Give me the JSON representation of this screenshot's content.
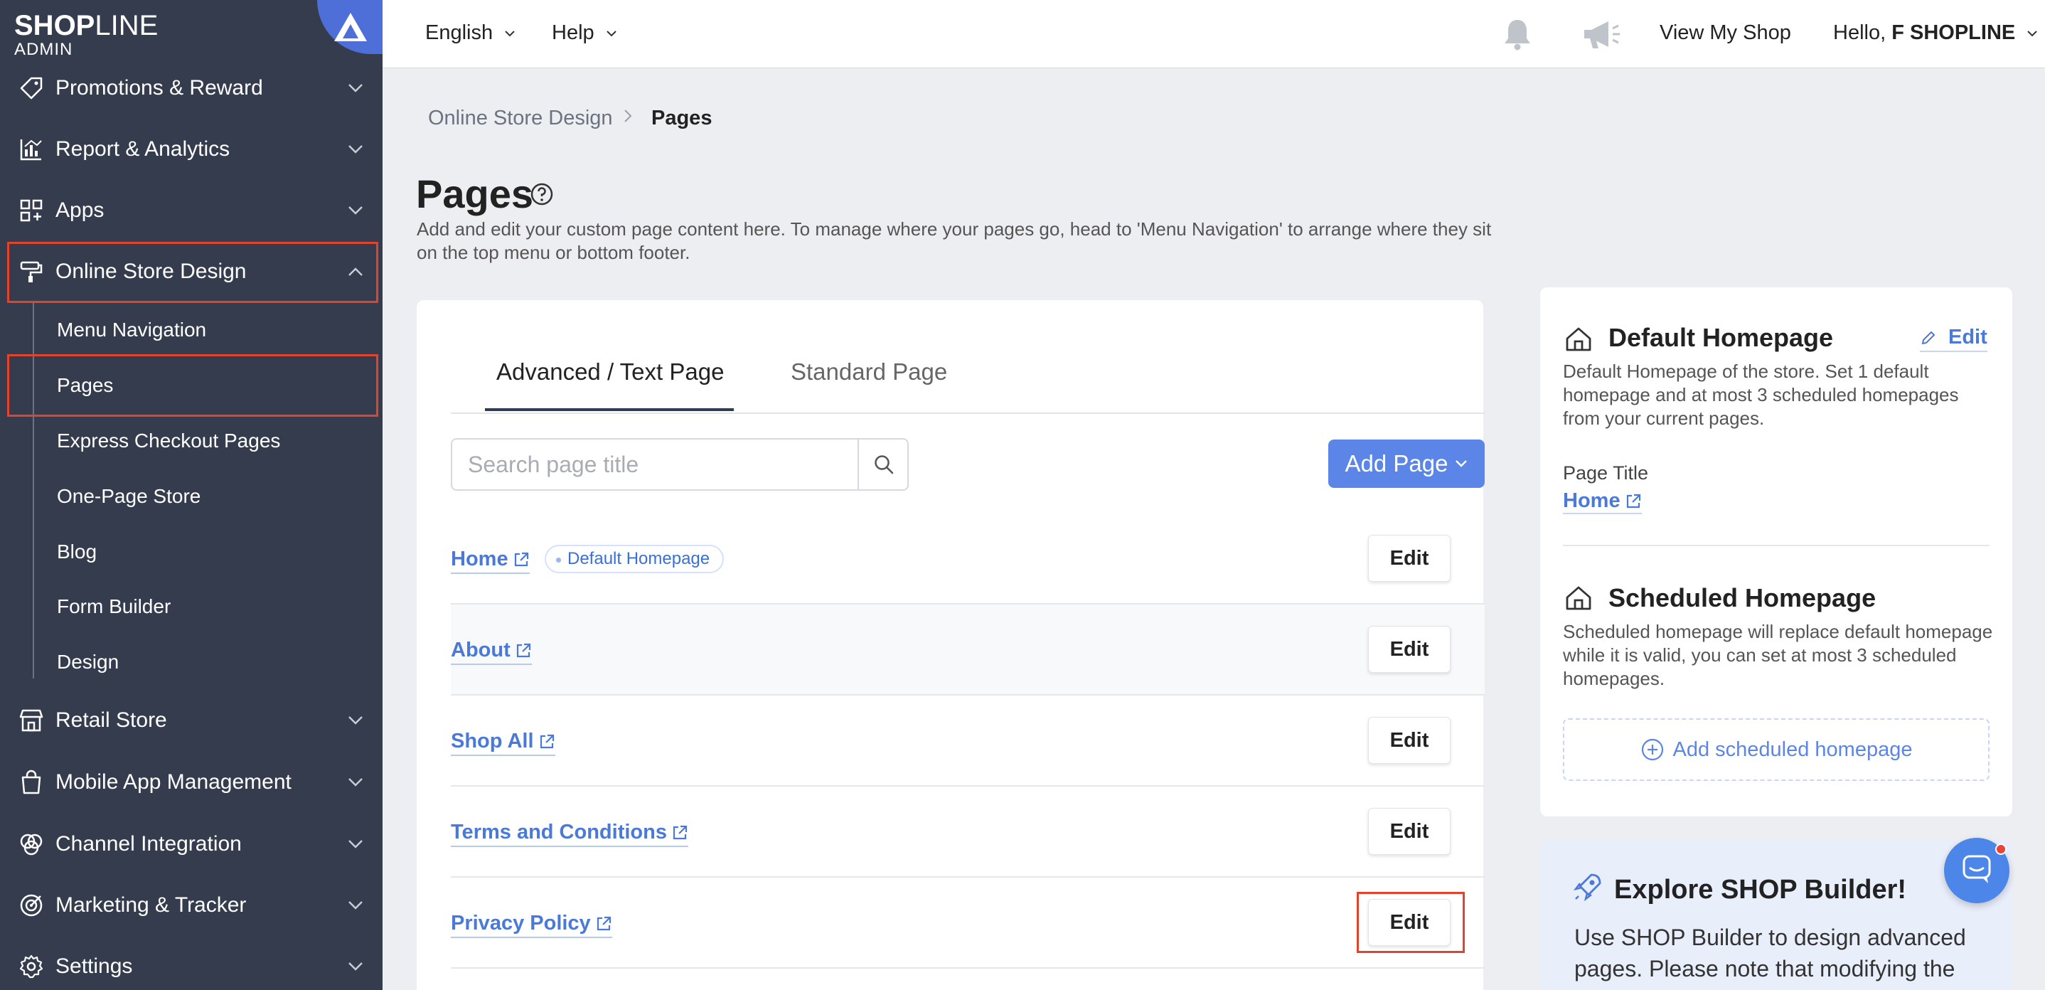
{
  "brand": {
    "name_bold": "SHOP",
    "name_rest": "LINE",
    "sub": "ADMIN"
  },
  "sidebar": {
    "items": [
      {
        "label": "Promotions & Reward",
        "icon": "tag-icon"
      },
      {
        "label": "Report & Analytics",
        "icon": "chart-icon"
      },
      {
        "label": "Apps",
        "icon": "apps-icon"
      },
      {
        "label": "Online Store Design",
        "icon": "paint-roller-icon",
        "expanded": true
      },
      {
        "label": "Retail Store",
        "icon": "store-icon"
      },
      {
        "label": "Mobile App Management",
        "icon": "shopping-bag-icon"
      },
      {
        "label": "Channel Integration",
        "icon": "channel-icon"
      },
      {
        "label": "Marketing & Tracker",
        "icon": "target-icon"
      },
      {
        "label": "Settings",
        "icon": "gear-icon"
      }
    ],
    "sub_items": [
      "Menu Navigation",
      "Pages",
      "Express Checkout Pages",
      "One-Page Store",
      "Blog",
      "Form Builder",
      "Design"
    ],
    "active_sub": "Pages"
  },
  "topbar": {
    "language": "English",
    "help": "Help",
    "view_shop": "View My Shop",
    "greeting": "Hello,",
    "user": "F SHOPLINE"
  },
  "breadcrumb": {
    "parent": "Online Store Design",
    "sep": ">",
    "current": "Pages"
  },
  "page": {
    "title": "Pages",
    "description": "Add and edit your custom page content here. To manage where your pages go, head to 'Menu Navigation' to arrange where they sit on the top menu or bottom footer."
  },
  "tabs": [
    {
      "label": "Advanced / Text Page",
      "active": true
    },
    {
      "label": "Standard Page",
      "active": false
    }
  ],
  "search": {
    "placeholder": "Search page title",
    "value": ""
  },
  "add_page": {
    "label": "Add Page"
  },
  "rows": [
    {
      "title": "Home",
      "badge": "Default Homepage",
      "edit": "Edit"
    },
    {
      "title": "About",
      "badge": null,
      "edit": "Edit"
    },
    {
      "title": "Shop All",
      "badge": null,
      "edit": "Edit"
    },
    {
      "title": "Terms and Conditions",
      "badge": null,
      "edit": "Edit"
    },
    {
      "title": "Privacy Policy",
      "badge": null,
      "edit": "Edit"
    }
  ],
  "right_panel": {
    "default_homepage": {
      "title": "Default Homepage",
      "edit": "Edit",
      "description": "Default Homepage of the store. Set 1 default homepage and at most 3 scheduled homepages from your current pages.",
      "page_title_label": "Page Title",
      "page_title_value": "Home"
    },
    "scheduled_homepage": {
      "title": "Scheduled Homepage",
      "description": "Scheduled homepage will replace default homepage while it is valid, you can set at most 3 scheduled homepages.",
      "add_label": "Add scheduled homepage"
    },
    "explore": {
      "title": "Explore SHOP Builder!",
      "text": "Use SHOP Builder to design advanced pages. Please note that modifying the"
    }
  },
  "colors": {
    "sidebar_bg": "#343c4e",
    "accent": "#5b85e6",
    "link": "#4a79d8",
    "highlight": "#e0442c"
  }
}
